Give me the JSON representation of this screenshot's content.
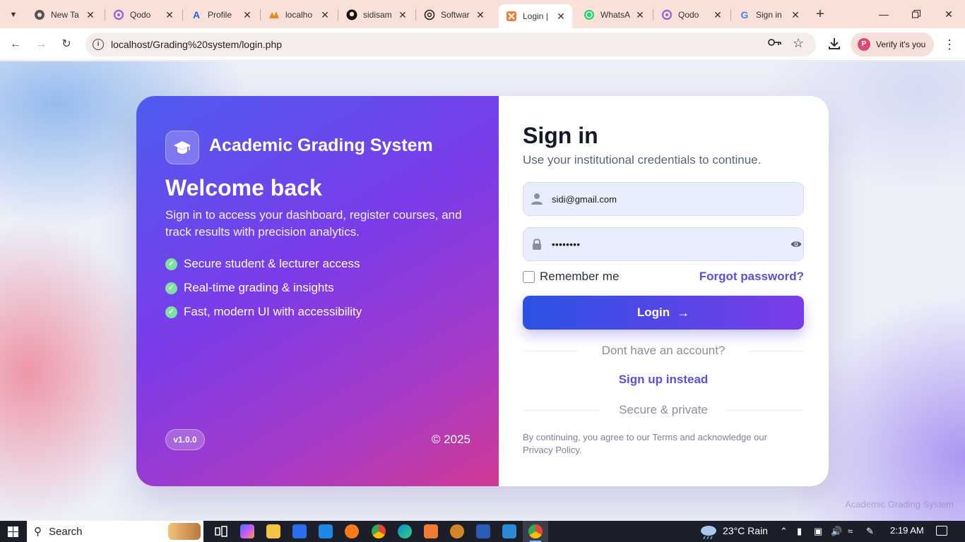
{
  "browser": {
    "tabs": [
      {
        "label": "New Ta",
        "icon": "chrome-icon"
      },
      {
        "label": "Qodo",
        "icon": "qodo-icon"
      },
      {
        "label": "Profile",
        "icon": "profile-a-icon"
      },
      {
        "label": "localho",
        "icon": "phpmyadmin-icon"
      },
      {
        "label": "sidisam",
        "icon": "github-icon"
      },
      {
        "label": "Softwar",
        "icon": "openai-icon"
      },
      {
        "label": "Login |",
        "icon": "xampp-icon",
        "active": true
      },
      {
        "label": "WhatsA",
        "icon": "whatsapp-icon"
      },
      {
        "label": "Qodo",
        "icon": "qodo-icon"
      },
      {
        "label": "Sign in",
        "icon": "google-icon"
      }
    ],
    "url": "localhost/Grading%20system/login.php",
    "profile_label": "Verify it's you",
    "profile_initial": "P"
  },
  "hero": {
    "brand": "Academic Grading System",
    "welcome": "Welcome back",
    "subtitle": "Sign in to access your dashboard, register courses, and track results with precision analytics.",
    "features": [
      "Secure student & lecturer access",
      "Real-time grading & insights",
      "Fast, modern UI with accessibility"
    ],
    "version": "v1.0.0",
    "copyright": "© 2025"
  },
  "form": {
    "title": "Sign in",
    "subtitle": "Use your institutional credentials to continue.",
    "email_value": "sidi@gmail.com",
    "password_value": "••••••••",
    "remember_label": "Remember me",
    "forgot_label": "Forgot password?",
    "login_label": "Login",
    "no_account_label": "Dont have an account?",
    "signup_label": "Sign up instead",
    "secure_label": "Secure & private",
    "terms_text": "By continuing, you agree to our Terms and acknowledge our Privacy Policy."
  },
  "watermark": "Academic Grading System",
  "taskbar": {
    "search_label": "Search",
    "weather": "23°C  Rain",
    "time": "2:19 AM"
  },
  "colors": {
    "accent": "#5b4fd8",
    "hero_start": "#4e5cf0",
    "hero_end": "#d03a94",
    "check": "#7fe0a4"
  }
}
